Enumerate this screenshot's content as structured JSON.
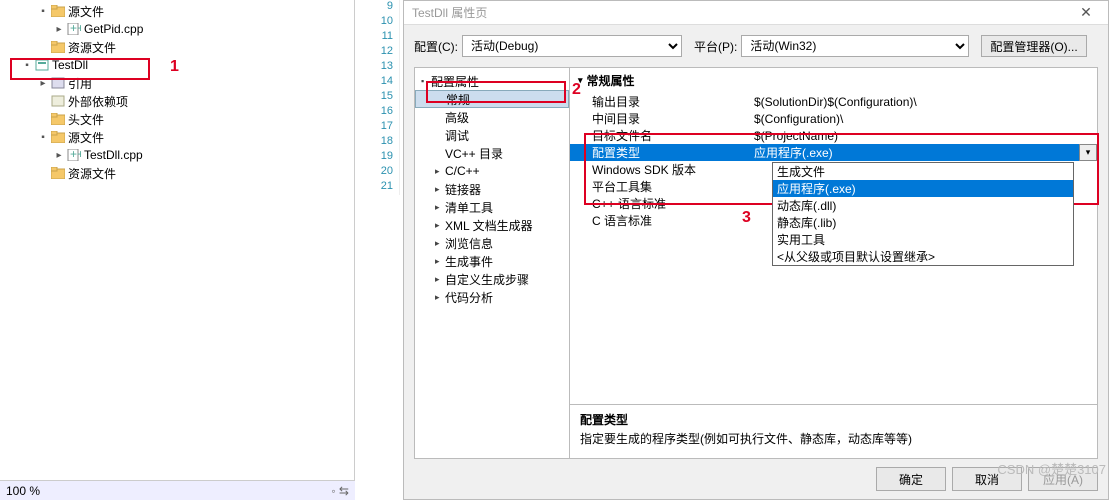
{
  "solution": {
    "items": [
      {
        "indent": 2,
        "tw": "▪",
        "icon": "folder",
        "label": "源文件"
      },
      {
        "indent": 3,
        "tw": "▸",
        "icon": "cpp",
        "label": "GetPid.cpp"
      },
      {
        "indent": 2,
        "tw": "",
        "icon": "folder",
        "label": "资源文件"
      },
      {
        "indent": 1,
        "tw": "▪",
        "icon": "proj",
        "label": "TestDll"
      },
      {
        "indent": 2,
        "tw": "▸",
        "icon": "ref",
        "label": "引用"
      },
      {
        "indent": 2,
        "tw": "",
        "icon": "ext",
        "label": "外部依赖项"
      },
      {
        "indent": 2,
        "tw": "",
        "icon": "folder",
        "label": "头文件"
      },
      {
        "indent": 2,
        "tw": "▪",
        "icon": "folder",
        "label": "源文件"
      },
      {
        "indent": 3,
        "tw": "▸",
        "icon": "cpp",
        "label": "TestDll.cpp"
      },
      {
        "indent": 2,
        "tw": "",
        "icon": "folder",
        "label": "资源文件"
      }
    ],
    "zoom": "100 %"
  },
  "gutter": [
    "9",
    "10",
    "11",
    "12",
    "13",
    "14",
    "15",
    "16",
    "17",
    "18",
    "19",
    "20",
    "21"
  ],
  "dialog": {
    "title": "TestDll 属性页",
    "config_label": "配置(C):",
    "config_value": "活动(Debug)",
    "platform_label": "平台(P):",
    "platform_value": "活动(Win32)",
    "mgr_btn": "配置管理器(O)...",
    "nav": [
      {
        "tw": "▪",
        "label": "配置属性",
        "indent": 0
      },
      {
        "tw": "",
        "label": "常规",
        "indent": 1,
        "sel": true
      },
      {
        "tw": "",
        "label": "高级",
        "indent": 1
      },
      {
        "tw": "",
        "label": "调试",
        "indent": 1
      },
      {
        "tw": "",
        "label": "VC++ 目录",
        "indent": 1
      },
      {
        "tw": "▸",
        "label": "C/C++",
        "indent": 1
      },
      {
        "tw": "▸",
        "label": "链接器",
        "indent": 1
      },
      {
        "tw": "▸",
        "label": "清单工具",
        "indent": 1
      },
      {
        "tw": "▸",
        "label": "XML 文档生成器",
        "indent": 1
      },
      {
        "tw": "▸",
        "label": "浏览信息",
        "indent": 1
      },
      {
        "tw": "▸",
        "label": "生成事件",
        "indent": 1
      },
      {
        "tw": "▸",
        "label": "自定义生成步骤",
        "indent": 1
      },
      {
        "tw": "▸",
        "label": "代码分析",
        "indent": 1
      }
    ],
    "section": "常规属性",
    "props": [
      {
        "k": "输出目录",
        "v": "$(SolutionDir)$(Configuration)\\"
      },
      {
        "k": "中间目录",
        "v": "$(Configuration)\\"
      },
      {
        "k": "目标文件名",
        "v": "$(ProjectName)"
      },
      {
        "k": "配置类型",
        "v": "应用程序(.exe)",
        "sel": true
      },
      {
        "k": "Windows SDK 版本",
        "v": ""
      },
      {
        "k": "平台工具集",
        "v": ""
      },
      {
        "k": "C++ 语言标准",
        "v": ""
      },
      {
        "k": "C 语言标准",
        "v": ""
      }
    ],
    "dropdown": [
      "生成文件",
      "应用程序(.exe)",
      "动态库(.dll)",
      "静态库(.lib)",
      "实用工具",
      "<从父级或项目默认设置继承>"
    ],
    "dropdown_sel": 1,
    "desc_title": "配置类型",
    "desc_text": "指定要生成的程序类型(例如可执行文件、静态库，动态库等等)",
    "ok": "确定",
    "cancel": "取消",
    "apply": "应用(A)"
  },
  "annotations": {
    "a1": "1",
    "a2": "2",
    "a3": "3"
  },
  "watermark": "CSDN @楚楚3107"
}
